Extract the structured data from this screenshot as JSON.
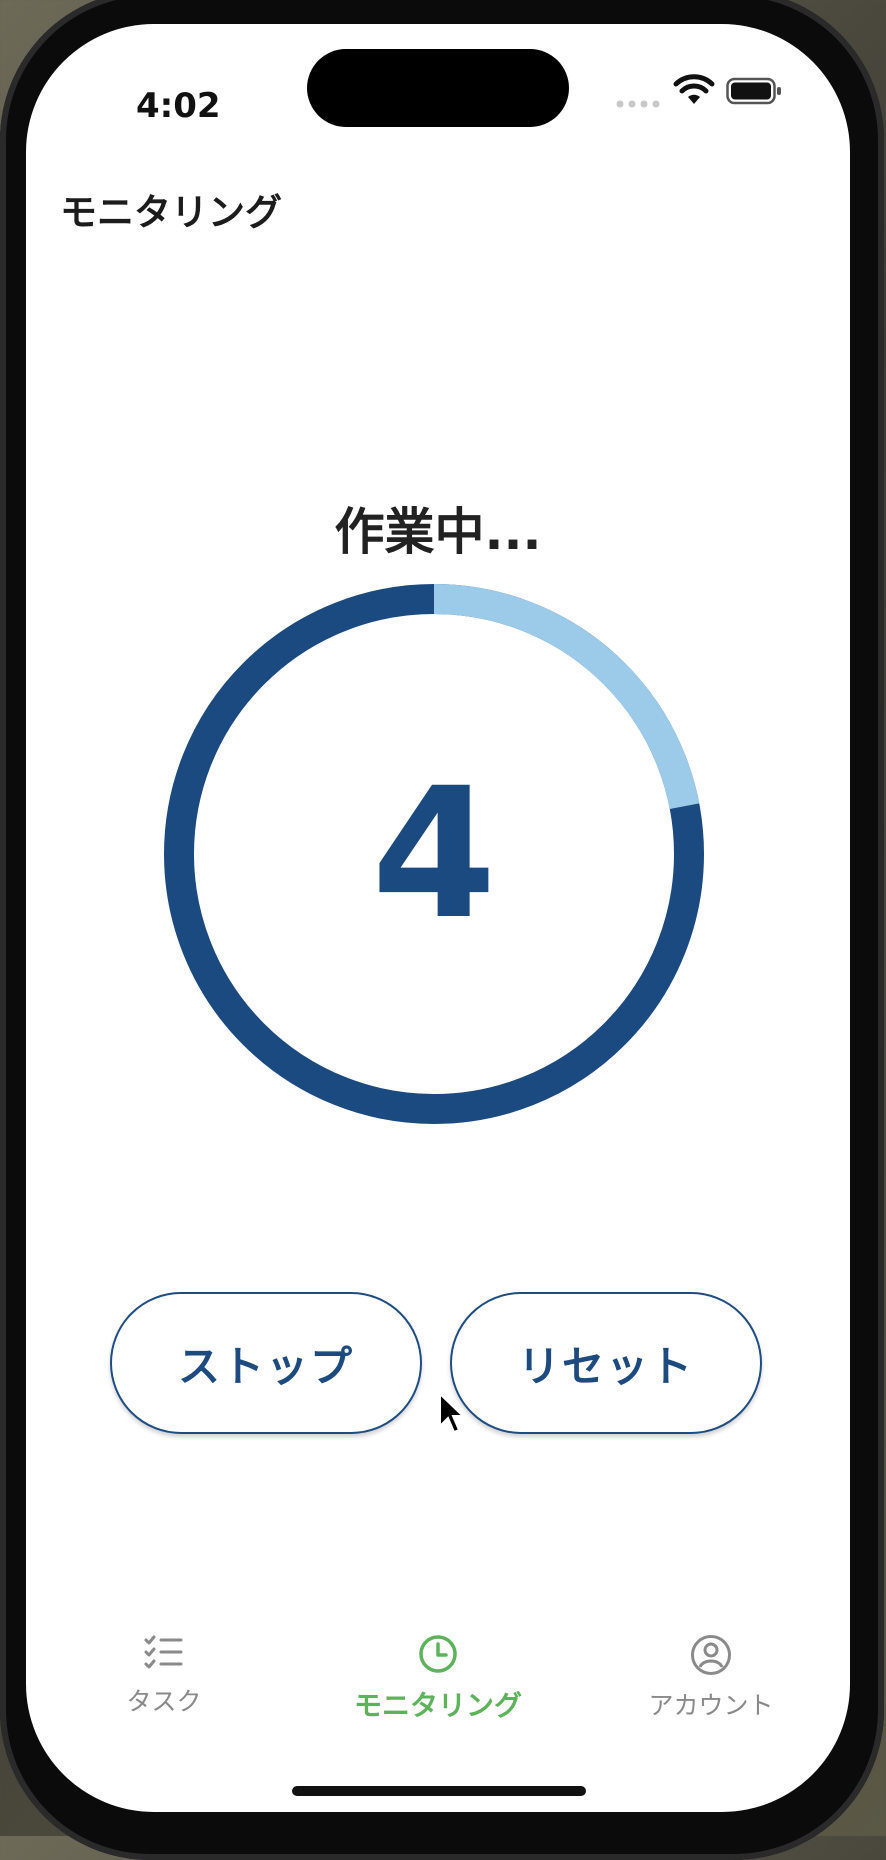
{
  "status_bar": {
    "time": "4:02"
  },
  "nav": {
    "title": "モニタリング"
  },
  "timer": {
    "status": "作業中...",
    "count": "4",
    "progress_fraction": 0.22,
    "ring_color": "#1b4a80",
    "progress_color": "#9bcbe9"
  },
  "buttons": {
    "stop": "ストップ",
    "reset": "リセット"
  },
  "tabs": [
    {
      "label": "タスク",
      "icon": "checklist-icon",
      "active": false
    },
    {
      "label": "モニタリング",
      "icon": "clock-icon",
      "active": true
    },
    {
      "label": "アカウント",
      "icon": "person-circle-icon",
      "active": false
    }
  ],
  "colors": {
    "active_tab": "#5db35a",
    "inactive_tab": "#8a8a8a",
    "accent": "#1b4a80"
  }
}
